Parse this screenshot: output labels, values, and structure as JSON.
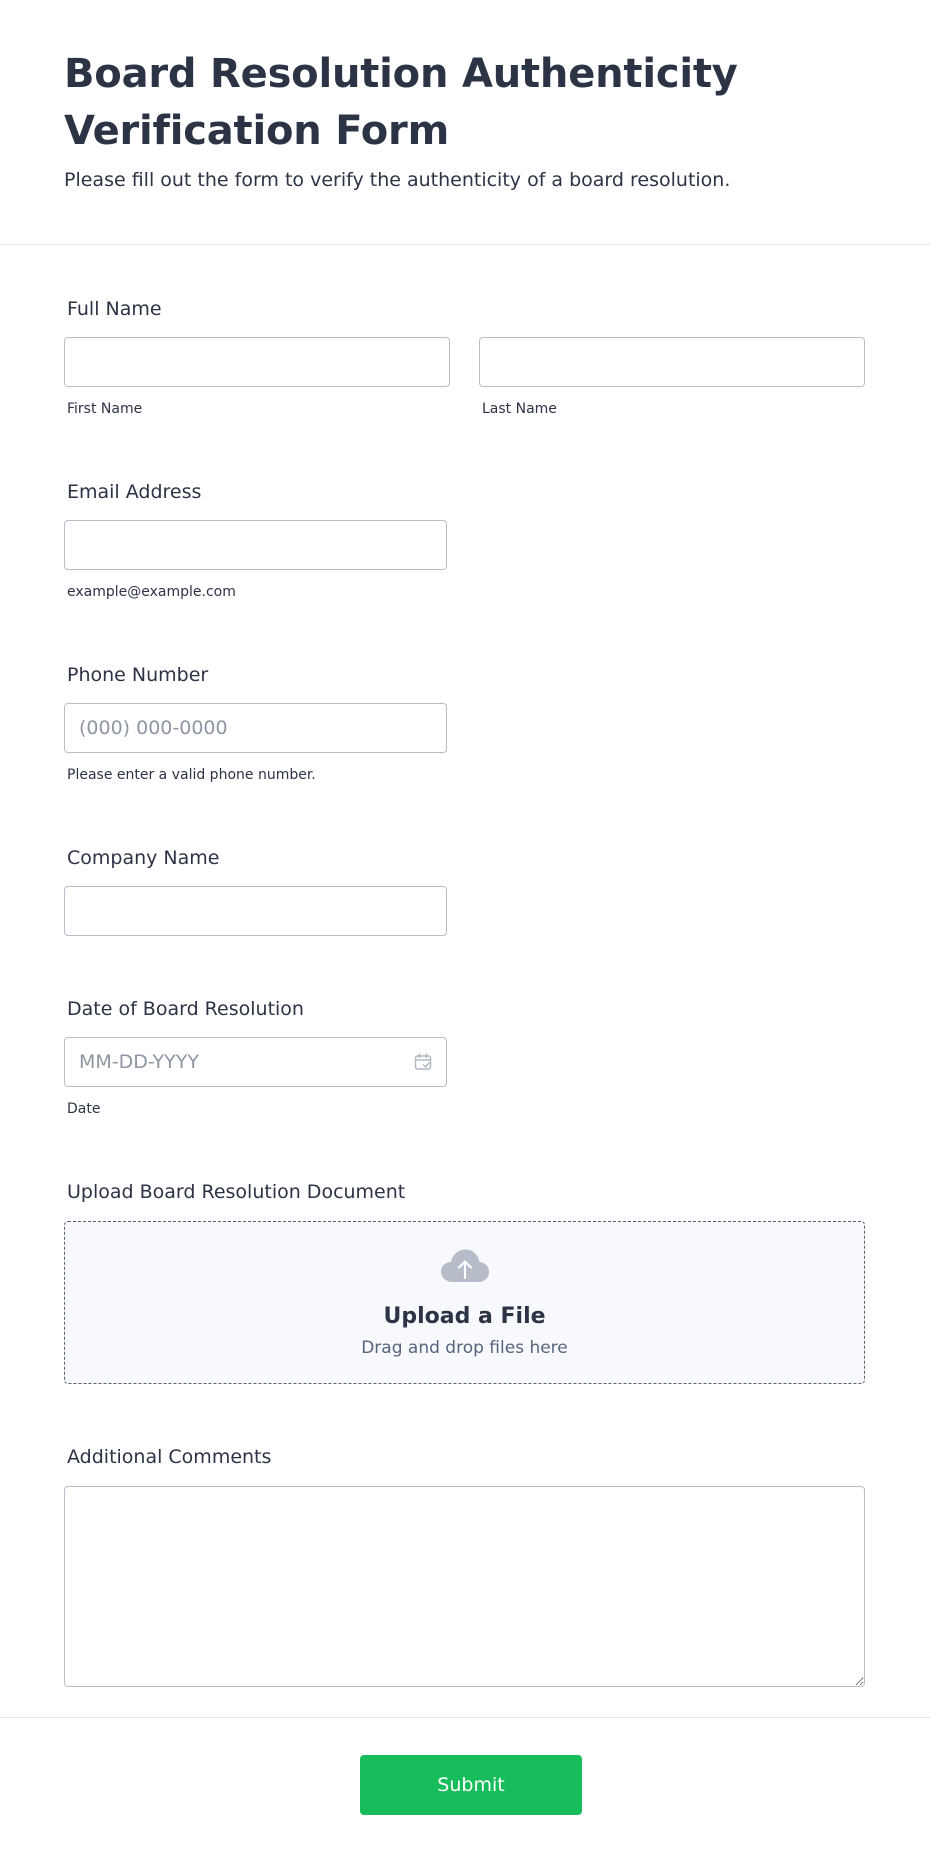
{
  "header": {
    "title": "Board Resolution Authenticity Verification Form",
    "subtitle": "Please fill out the form to verify the authenticity of a board resolution."
  },
  "fields": {
    "full_name": {
      "label": "Full Name",
      "first_value": "",
      "last_value": "",
      "first_sublabel": "First Name",
      "last_sublabel": "Last Name"
    },
    "email": {
      "label": "Email Address",
      "value": "",
      "sublabel": "example@example.com"
    },
    "phone": {
      "label": "Phone Number",
      "placeholder": "(000) 000-0000",
      "sublabel": "Please enter a valid phone number."
    },
    "company": {
      "label": "Company Name",
      "value": ""
    },
    "date": {
      "label": "Date of Board Resolution",
      "placeholder": "MM-DD-YYYY",
      "sublabel": "Date",
      "icon": "calendar-icon"
    },
    "upload": {
      "label": "Upload Board Resolution Document",
      "title": "Upload a File",
      "hint": "Drag and drop files here",
      "icon": "cloud-upload-icon"
    },
    "comments": {
      "label": "Additional Comments",
      "value": ""
    }
  },
  "submit": {
    "label": "Submit",
    "color": "#18bd5b"
  },
  "colors": {
    "text": "#2c3345",
    "border": "#b8bdc9",
    "upload_bg": "#f8f9fd",
    "placeholder": "#8f96a3"
  }
}
